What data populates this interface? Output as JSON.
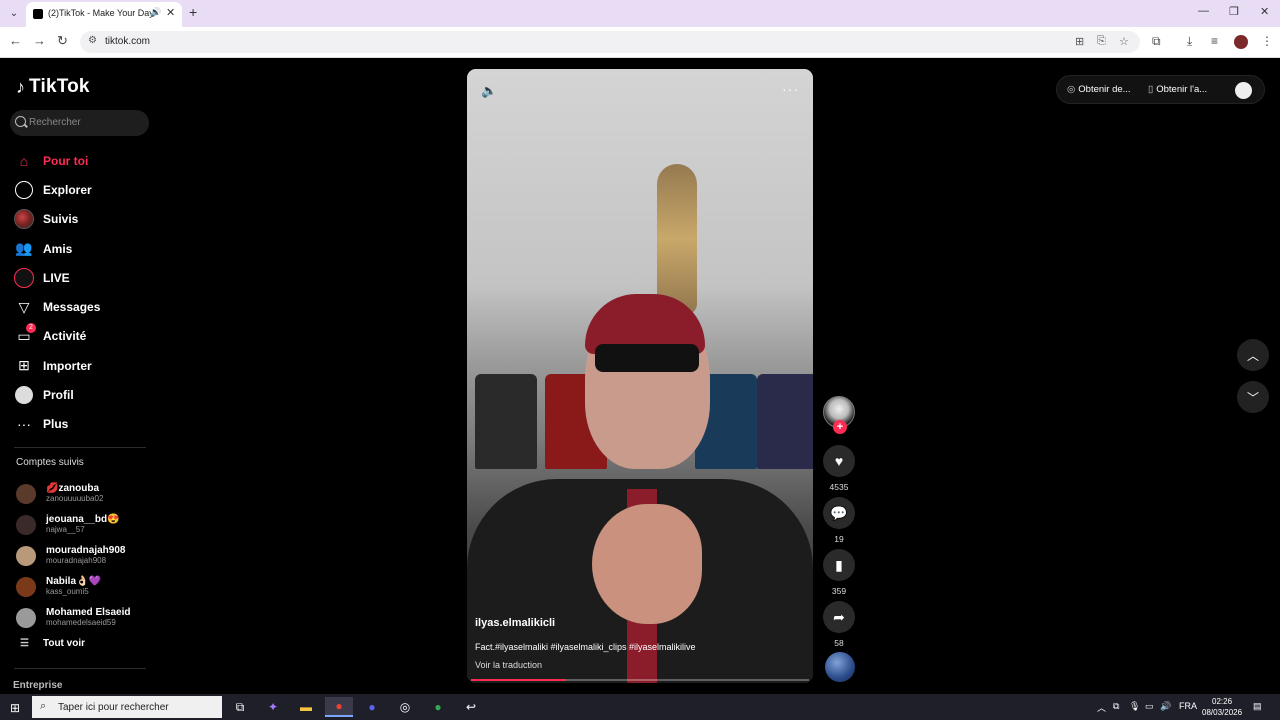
{
  "browser": {
    "tab_title": "(2)TikTok - Make Your Day",
    "tab_close": "✕",
    "new_tab": "+",
    "url": "tiktok.com",
    "window_controls": [
      "—",
      "❐",
      "✕"
    ]
  },
  "sidebar": {
    "logo_text": "TikTok",
    "search_placeholder": "Rechercher",
    "nav": [
      {
        "label": "Pour toi",
        "icon": "home-icon",
        "active": true
      },
      {
        "label": "Explorer",
        "icon": "compass-icon"
      },
      {
        "label": "Suivis",
        "icon": "following-avatar-icon"
      },
      {
        "label": "Amis",
        "icon": "friends-icon"
      },
      {
        "label": "LIVE",
        "icon": "live-icon"
      },
      {
        "label": "Messages",
        "icon": "messages-icon"
      },
      {
        "label": "Activité",
        "icon": "activity-icon",
        "badge": "2"
      },
      {
        "label": "Importer",
        "icon": "upload-icon"
      },
      {
        "label": "Profil",
        "icon": "profile-icon"
      },
      {
        "label": "Plus",
        "icon": "more-icon"
      }
    ],
    "followed_title": "Comptes suivis",
    "followed": [
      {
        "name": "💋zanouba",
        "handle": "zanouuuuuba02",
        "color": "#5a3a2a"
      },
      {
        "name": "jeouana__bd😍",
        "handle": "najwa__57",
        "color": "#3a2a2a"
      },
      {
        "name": "mouradnajah908",
        "handle": "mouradnajah908",
        "color": "#b89a7a"
      },
      {
        "name": "Nabila👌🏻💜",
        "handle": "kass_oumi5",
        "color": "#7a3a1a"
      },
      {
        "name": "Mohamed Elsaeid",
        "handle": "mohamedelsaeid59",
        "color": "#9a9a9a"
      }
    ],
    "see_all": "Tout voir",
    "enterprise": "Entreprise"
  },
  "video": {
    "author": "ilyas.elmalikicli",
    "caption": "Fact.#ilyaselmaliki #ilyaselmaliki_clips #ilyaselmalikilive",
    "translate": "Voir la traduction",
    "progress": 0.28
  },
  "actions": {
    "likes": "4535",
    "comments": "19",
    "saves": "359",
    "shares": "58"
  },
  "top_right": {
    "get_coins": "Obtenir de...",
    "get_app": "Obtenir l'a..."
  },
  "taskbar": {
    "search_text": "Taper ici pour rechercher",
    "lang": "FRA",
    "time": "02:26",
    "date": "08/03/2026"
  }
}
